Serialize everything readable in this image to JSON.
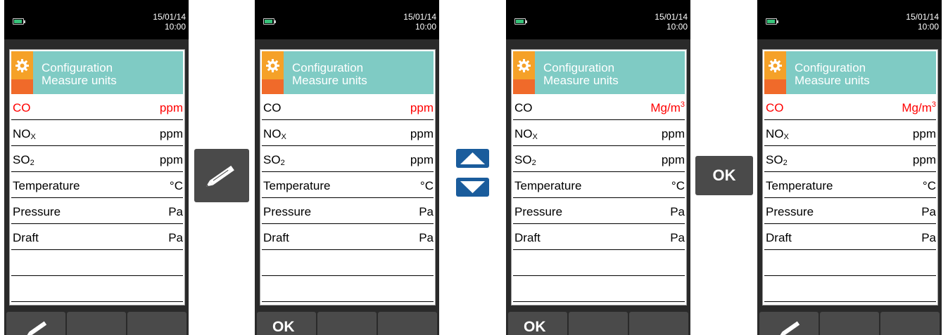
{
  "screens": [
    {
      "datetime": {
        "date": "15/01/14",
        "time": "10:00"
      },
      "panel": {
        "title1": "Configuration",
        "title2": "Measure units"
      },
      "rows": [
        {
          "label": "CO",
          "sub": "",
          "value": "ppm",
          "sup": "",
          "label_red": true,
          "value_red": true
        },
        {
          "label": "NO",
          "sub": "X",
          "value": "ppm",
          "sup": "",
          "label_red": false,
          "value_red": false
        },
        {
          "label": "SO",
          "sub": "2",
          "value": "ppm",
          "sup": "",
          "label_red": false,
          "value_red": false
        },
        {
          "label": "Temperature",
          "sub": "",
          "value": "°C",
          "sup": "",
          "label_red": false,
          "value_red": false
        },
        {
          "label": "Pressure",
          "sub": "",
          "value": "Pa",
          "sup": "",
          "label_red": false,
          "value_red": false
        },
        {
          "label": "Draft",
          "sub": "",
          "value": "Pa",
          "sup": "",
          "label_red": false,
          "value_red": false
        }
      ],
      "softkey_left": {
        "type": "pencil-icon",
        "label": ""
      }
    },
    {
      "datetime": {
        "date": "15/01/14",
        "time": "10:00"
      },
      "panel": {
        "title1": "Configuration",
        "title2": "Measure units"
      },
      "rows": [
        {
          "label": "CO",
          "sub": "",
          "value": "ppm",
          "sup": "",
          "label_red": false,
          "value_red": true
        },
        {
          "label": "NO",
          "sub": "X",
          "value": "ppm",
          "sup": "",
          "label_red": false,
          "value_red": false
        },
        {
          "label": "SO",
          "sub": "2",
          "value": "ppm",
          "sup": "",
          "label_red": false,
          "value_red": false
        },
        {
          "label": "Temperature",
          "sub": "",
          "value": "°C",
          "sup": "",
          "label_red": false,
          "value_red": false
        },
        {
          "label": "Pressure",
          "sub": "",
          "value": "Pa",
          "sup": "",
          "label_red": false,
          "value_red": false
        },
        {
          "label": "Draft",
          "sub": "",
          "value": "Pa",
          "sup": "",
          "label_red": false,
          "value_red": false
        }
      ],
      "softkey_left": {
        "type": "ok",
        "label": "OK"
      }
    },
    {
      "datetime": {
        "date": "15/01/14",
        "time": "10:00"
      },
      "panel": {
        "title1": "Configuration",
        "title2": "Measure units"
      },
      "rows": [
        {
          "label": "CO",
          "sub": "",
          "value": "Mg/m",
          "sup": "3",
          "label_red": false,
          "value_red": true
        },
        {
          "label": "NO",
          "sub": "X",
          "value": "ppm",
          "sup": "",
          "label_red": false,
          "value_red": false
        },
        {
          "label": "SO",
          "sub": "2",
          "value": "ppm",
          "sup": "",
          "label_red": false,
          "value_red": false
        },
        {
          "label": "Temperature",
          "sub": "",
          "value": "°C",
          "sup": "",
          "label_red": false,
          "value_red": false
        },
        {
          "label": "Pressure",
          "sub": "",
          "value": "Pa",
          "sup": "",
          "label_red": false,
          "value_red": false
        },
        {
          "label": "Draft",
          "sub": "",
          "value": "Pa",
          "sup": "",
          "label_red": false,
          "value_red": false
        }
      ],
      "softkey_left": {
        "type": "ok",
        "label": "OK"
      }
    },
    {
      "datetime": {
        "date": "15/01/14",
        "time": "10:00"
      },
      "panel": {
        "title1": "Configuration",
        "title2": "Measure units"
      },
      "rows": [
        {
          "label": "CO",
          "sub": "",
          "value": "Mg/m",
          "sup": "3",
          "label_red": true,
          "value_red": true
        },
        {
          "label": "NO",
          "sub": "X",
          "value": "ppm",
          "sup": "",
          "label_red": false,
          "value_red": false
        },
        {
          "label": "SO",
          "sub": "2",
          "value": "ppm",
          "sup": "",
          "label_red": false,
          "value_red": false
        },
        {
          "label": "Temperature",
          "sub": "",
          "value": "°C",
          "sup": "",
          "label_red": false,
          "value_red": false
        },
        {
          "label": "Pressure",
          "sub": "",
          "value": "Pa",
          "sup": "",
          "label_red": false,
          "value_red": false
        },
        {
          "label": "Draft",
          "sub": "",
          "value": "Pa",
          "sup": "",
          "label_red": false,
          "value_red": false
        }
      ],
      "softkey_left": {
        "type": "pencil-icon",
        "label": ""
      }
    }
  ],
  "actions": {
    "edit": {
      "icon": "pencil-icon"
    },
    "navigate": {
      "up_icon": "arrow-up-icon",
      "down_icon": "arrow-down-icon"
    },
    "confirm": {
      "label": "OK"
    }
  },
  "colors": {
    "header_teal": "#7fcbc4",
    "gear_orange": "#f06a2a",
    "gear_yellow": "#f5a128",
    "selected_red": "#ff0000",
    "arrow_blue": "#1a5c9c",
    "battery_green": "#37c37a"
  }
}
